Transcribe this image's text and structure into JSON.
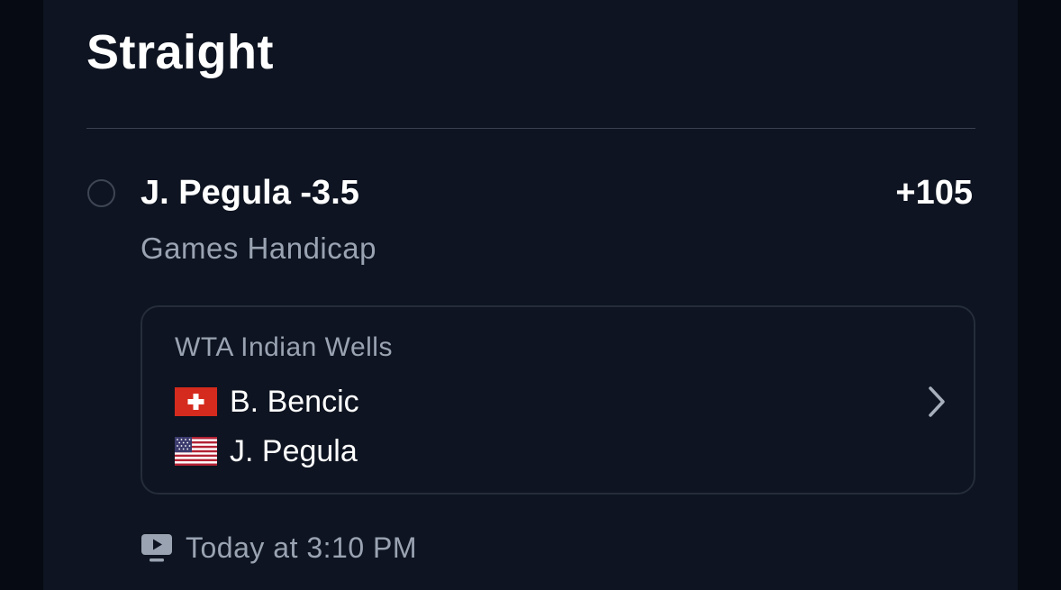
{
  "bet": {
    "section_title": "Straight",
    "selection": "J. Pegula -3.5",
    "odds": "+105",
    "market": "Games Handicap"
  },
  "event": {
    "league": "WTA Indian Wells",
    "players": [
      {
        "name": "B. Bencic",
        "flag_icon": "switzerland-flag-icon"
      },
      {
        "name": "J. Pegula",
        "flag_icon": "usa-flag-icon"
      }
    ],
    "start_time": "Today at 3:10 PM",
    "live_stream_icon": "tv-icon"
  },
  "colors": {
    "background": "#060a12",
    "panel": "#0e1421",
    "text_primary": "#ffffff",
    "text_secondary": "#9aa3b2",
    "border": "#252c3a"
  }
}
